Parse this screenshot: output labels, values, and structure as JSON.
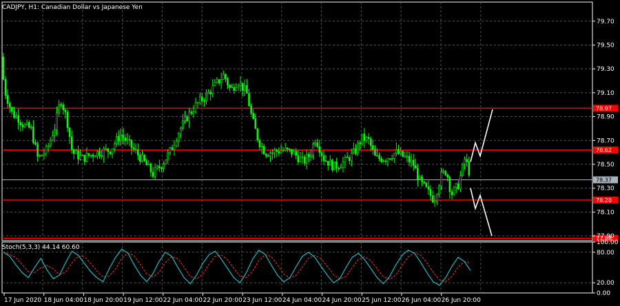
{
  "chart_title": "CADJPY, H1:  Canadian Dollar vs Japanese Yen",
  "indicator_title": "Stoch(5,3,3) 44.14 60.60",
  "colors": {
    "background": "#000000",
    "grid": "#4a5a4a",
    "bull": "#00ff00",
    "bear": "#00ff00",
    "level": "#ff0000",
    "current": "#aab2bb",
    "stoch_main": "#1fb8c6",
    "stoch_signal": "#ff3030",
    "arrow": "#ffffff"
  },
  "chart_data": [
    {
      "type": "candlestick",
      "symbol": "CADJPY",
      "timeframe": "H1",
      "ylim": [
        77.86,
        79.86
      ],
      "y_ticks": [
        "79.70",
        "79.50",
        "79.30",
        "79.10",
        "78.90",
        "78.70",
        "78.50",
        "78.30",
        "78.10",
        "77.90"
      ],
      "x_ticks": [
        "17 Jun 2020",
        "18 Jun 04:00",
        "18 Jun 20:00",
        "19 Jun 12:00",
        "22 Jun 04:00",
        "22 Jun 20:00",
        "23 Jun 12:00",
        "24 Jun 04:00",
        "24 Jun 20:00",
        "25 Jun 12:00",
        "26 Jun 04:00",
        "26 Jun 20:00"
      ],
      "current_price": "78.37",
      "levels": [
        {
          "label": "78.97",
          "value": 78.97
        },
        {
          "label": "78.62",
          "value": 78.62
        },
        {
          "label": "78.20",
          "value": 78.2
        },
        {
          "label": "77.88",
          "value": 77.88
        }
      ],
      "price_path": [
        [
          0,
          79.4
        ],
        [
          8,
          79.1
        ],
        [
          18,
          78.92
        ],
        [
          25,
          78.9
        ],
        [
          35,
          78.82
        ],
        [
          45,
          78.8
        ],
        [
          55,
          78.55
        ],
        [
          68,
          78.62
        ],
        [
          80,
          78.82
        ],
        [
          88,
          79.05
        ],
        [
          97,
          78.88
        ],
        [
          105,
          78.6
        ],
        [
          120,
          78.55
        ],
        [
          140,
          78.6
        ],
        [
          160,
          78.62
        ],
        [
          175,
          78.75
        ],
        [
          190,
          78.65
        ],
        [
          205,
          78.55
        ],
        [
          222,
          78.42
        ],
        [
          235,
          78.5
        ],
        [
          248,
          78.62
        ],
        [
          260,
          78.78
        ],
        [
          272,
          78.9
        ],
        [
          285,
          79.0
        ],
        [
          300,
          79.08
        ],
        [
          315,
          79.18
        ],
        [
          325,
          79.25
        ],
        [
          335,
          79.12
        ],
        [
          345,
          79.2
        ],
        [
          358,
          79.1
        ],
        [
          366,
          78.88
        ],
        [
          375,
          78.7
        ],
        [
          385,
          78.6
        ],
        [
          395,
          78.6
        ],
        [
          410,
          78.62
        ],
        [
          425,
          78.6
        ],
        [
          440,
          78.52
        ],
        [
          450,
          78.58
        ],
        [
          458,
          78.72
        ],
        [
          470,
          78.55
        ],
        [
          485,
          78.48
        ],
        [
          500,
          78.52
        ],
        [
          515,
          78.6
        ],
        [
          525,
          78.72
        ],
        [
          535,
          78.7
        ],
        [
          545,
          78.55
        ],
        [
          560,
          78.55
        ],
        [
          575,
          78.6
        ],
        [
          590,
          78.55
        ],
        [
          600,
          78.5
        ],
        [
          610,
          78.35
        ],
        [
          620,
          78.28
        ],
        [
          630,
          78.2
        ],
        [
          640,
          78.4
        ],
        [
          648,
          78.45
        ],
        [
          655,
          78.25
        ],
        [
          665,
          78.32
        ],
        [
          675,
          78.55
        ],
        [
          683,
          78.4
        ]
      ],
      "projection_up": [
        [
          683,
          78.52
        ],
        [
          690,
          78.68
        ],
        [
          697,
          78.57
        ],
        [
          715,
          78.96
        ]
      ],
      "projection_down": [
        [
          683,
          78.3
        ],
        [
          690,
          78.13
        ],
        [
          697,
          78.24
        ],
        [
          714,
          77.9
        ]
      ]
    },
    {
      "type": "line",
      "name": "Stoch(5,3,3)",
      "ylim": [
        0,
        100
      ],
      "y_ticks": [
        "100.00",
        "80.00",
        "20.00",
        "0.00"
      ],
      "main_value": 44.14,
      "signal_value": 60.6,
      "main_values": [
        80,
        72,
        55,
        40,
        30,
        50,
        68,
        45,
        28,
        35,
        60,
        82,
        74,
        58,
        42,
        30,
        22,
        48,
        70,
        86,
        78,
        55,
        35,
        22,
        38,
        62,
        80,
        72,
        50,
        30,
        18,
        35,
        58,
        75,
        82,
        66,
        48,
        30,
        20,
        40,
        66,
        84,
        76,
        55,
        35,
        22,
        30,
        52,
        72,
        80,
        70,
        52,
        35,
        20,
        28,
        50,
        70,
        78,
        65,
        48,
        30,
        18,
        32,
        55,
        74,
        84,
        78,
        60,
        40,
        22,
        15,
        30,
        52,
        70,
        62,
        44
      ]
    }
  ]
}
